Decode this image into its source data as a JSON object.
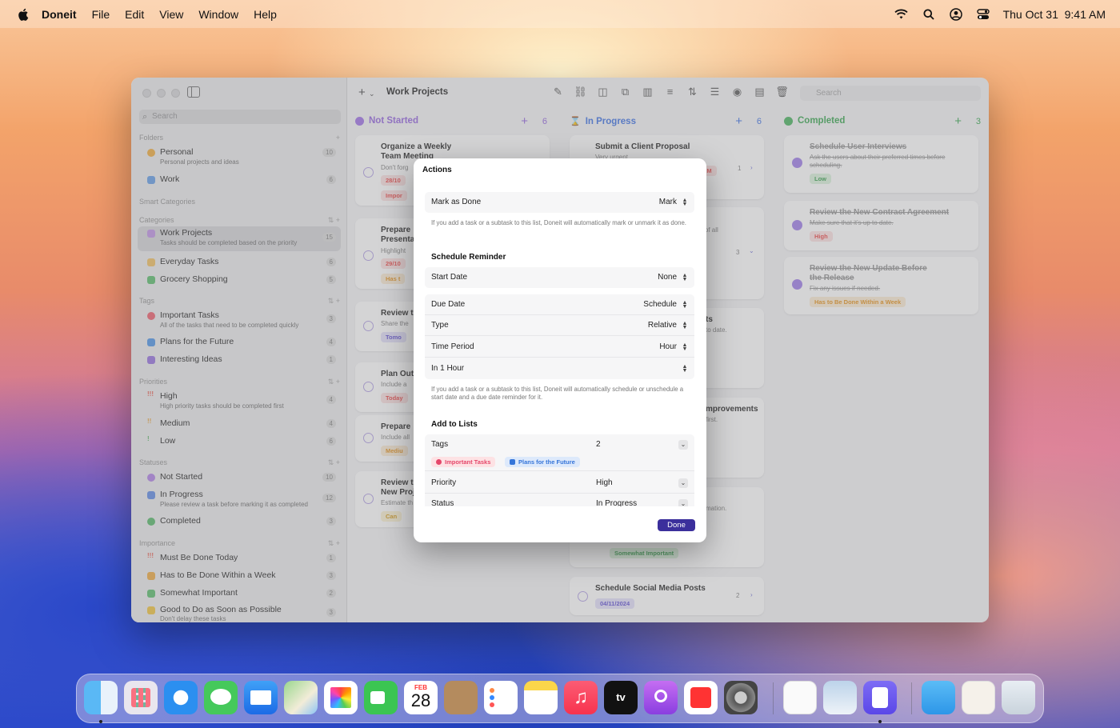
{
  "menubar": {
    "app_name": "Doneit",
    "menus": [
      "File",
      "Edit",
      "View",
      "Window",
      "Help"
    ],
    "datetime": "Thu Oct 31  9:41 AM"
  },
  "sidebar": {
    "search_placeholder": "Search",
    "sections": {
      "folders": "Folders",
      "smart": "Smart Categories",
      "categories": "Categories",
      "tags": "Tags",
      "priorities": "Priorities",
      "statuses": "Statuses",
      "importance": "Importance"
    },
    "folders": [
      {
        "name": "Personal",
        "sub": "Personal projects and ideas",
        "count": "10"
      },
      {
        "name": "Work",
        "sub": "",
        "count": "6"
      }
    ],
    "categories": [
      {
        "name": "Work Projects",
        "sub": "Tasks should be completed based on the priority",
        "count": "15"
      },
      {
        "name": "Everyday Tasks",
        "sub": "",
        "count": "6"
      },
      {
        "name": "Grocery Shopping",
        "sub": "",
        "count": "5"
      }
    ],
    "tags": [
      {
        "name": "Important Tasks",
        "sub": "All of the tasks that need to be completed quickly",
        "count": "3"
      },
      {
        "name": "Plans for the Future",
        "sub": "",
        "count": "4"
      },
      {
        "name": "Interesting Ideas",
        "sub": "",
        "count": "1"
      }
    ],
    "priorities": [
      {
        "name": "High",
        "sub": "High priority tasks should be completed first",
        "count": "4"
      },
      {
        "name": "Medium",
        "sub": "",
        "count": "4"
      },
      {
        "name": "Low",
        "sub": "",
        "count": "6"
      }
    ],
    "statuses": [
      {
        "name": "Not Started",
        "sub": "",
        "count": "10"
      },
      {
        "name": "In Progress",
        "sub": "Please review a task before marking it as completed",
        "count": "12"
      },
      {
        "name": "Completed",
        "sub": "",
        "count": "3"
      }
    ],
    "importance": [
      {
        "name": "Must Be Done Today",
        "sub": "",
        "count": "1"
      },
      {
        "name": "Has to Be Done Within a Week",
        "sub": "",
        "count": "3"
      },
      {
        "name": "Somewhat Important",
        "sub": "",
        "count": "2"
      },
      {
        "name": "Good to Do as Soon as Possible",
        "sub": "Don't delay these tasks",
        "count": "3"
      }
    ]
  },
  "toolbar": {
    "title": "Work Projects",
    "search_placeholder": "Search"
  },
  "columns": [
    {
      "title": "Not Started",
      "count": "6",
      "color": "#a57be8"
    },
    {
      "title": "In Progress",
      "count": "6",
      "color": "#4b7be5"
    },
    {
      "title": "Completed",
      "count": "3",
      "color": "#56b96a"
    }
  ],
  "not_started_cards": [
    {
      "title": "Organize a Weekly",
      "title2": "Team Meeting",
      "sub": "Don't forg",
      "tag": "28/10",
      "tag2": "Impor"
    },
    {
      "title": "Prepare",
      "title2": "Presenta",
      "sub": "Highlight",
      "tag": "29/10",
      "tag2": "Has t"
    },
    {
      "title": "Review t",
      "title2": "",
      "sub": "Share the",
      "tag": "Tomo",
      "tag2": ""
    },
    {
      "title": "Plan Out",
      "title2": "",
      "sub": "Include a",
      "tag": "Today",
      "tag2": ""
    },
    {
      "title": "Prepare",
      "title2": "",
      "sub": "Include all",
      "tag": "Mediu",
      "tag2": ""
    },
    {
      "title": "Review t",
      "title2": "New Proj",
      "sub": "Estimate th",
      "tag": "Can",
      "tag2": ""
    }
  ],
  "in_progress_cards": [
    {
      "title": "Submit a Client Proposal",
      "sub": "Very urgent",
      "meta": "1",
      "tag": "AM"
    },
    {
      "title": "",
      "sub": "ry of all",
      "meta": "3",
      "tag": ""
    },
    {
      "title": "ts",
      "sub": "to date.",
      "meta": "",
      "tag": ""
    },
    {
      "title": "mprovements",
      "sub": "first.",
      "meta": "",
      "tag": ""
    },
    {
      "title": "",
      "sub": "mation.",
      "meta": "",
      "tag": "Somewhat Important"
    },
    {
      "title": "Schedule Social Media Posts",
      "sub": "",
      "meta": "2",
      "tag": "04/11/2024"
    }
  ],
  "completed_cards": [
    {
      "title": "Schedule User Interviews",
      "sub": "Ask the users about their preferred times before",
      "sub2": "scheduling.",
      "tag": "Low"
    },
    {
      "title": "Review the New Contract Agreement",
      "sub": "Make sure that it's up to date.",
      "sub2": "",
      "tag": "High"
    },
    {
      "title": "Review the New Update Before",
      "title2": "the Release",
      "sub": "Fix any issues if needed.",
      "sub2": "",
      "tag": "Has to Be Done Within a Week"
    }
  ],
  "modal": {
    "title": "Actions",
    "mark_as_done": {
      "label": "Mark as Done",
      "value": "Mark"
    },
    "mark_note": "If you add a task or a subtask to this list, Doneit will automatically mark or unmark it as done.",
    "schedule_header": "Schedule Reminder",
    "start_date": {
      "label": "Start Date",
      "value": "None"
    },
    "due_date": {
      "label": "Due Date",
      "value": "Schedule"
    },
    "type": {
      "label": "Type",
      "value": "Relative"
    },
    "time_period": {
      "label": "Time Period",
      "value": "Hour"
    },
    "in_one_hour": {
      "label": "In 1 Hour",
      "value": ""
    },
    "schedule_note": "If you add a task or a subtask to this list, Doneit will automatically schedule or unschedule a start date and a due date reminder for it.",
    "lists_header": "Add to Lists",
    "tags": {
      "label": "Tags",
      "value": "2",
      "pills": [
        "Important Tasks",
        "Plans for the Future"
      ]
    },
    "priority": {
      "label": "Priority",
      "value": "High"
    },
    "status": {
      "label": "Status",
      "value": "In Progress"
    },
    "done_label": "Done"
  },
  "dock": [
    "Finder",
    "Launchpad",
    "Safari",
    "Messages",
    "Mail",
    "Maps",
    "Photos",
    "FaceTime",
    "Calendar",
    "Contacts",
    "Reminders",
    "Notes",
    "Music",
    "TV",
    "Podcasts",
    "News",
    "System Settings",
    "TextEdit",
    "Preview",
    "Doneit",
    "Downloads",
    "Documents",
    "Trash"
  ],
  "calendar_icon": {
    "month": "FEB",
    "day": "28"
  }
}
